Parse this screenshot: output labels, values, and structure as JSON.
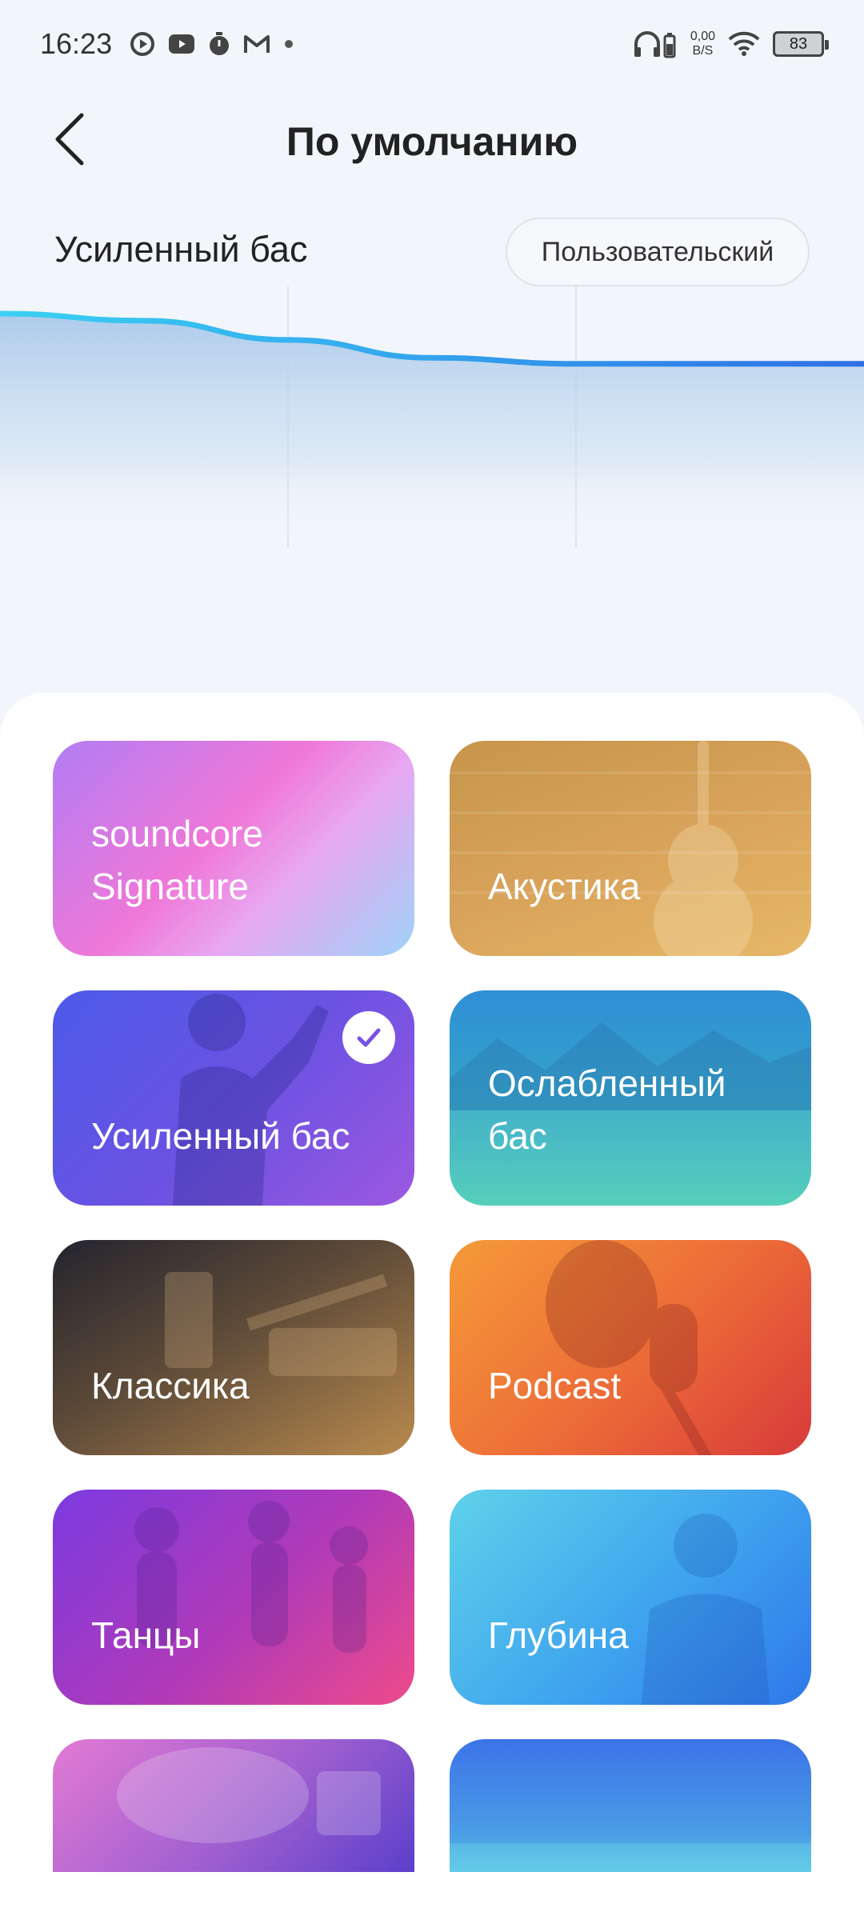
{
  "status_bar": {
    "time": "16:23",
    "net_speed_value": "0,00",
    "net_speed_unit": "B/S",
    "battery": "83",
    "icons": [
      "play-circle-icon",
      "youtube-icon",
      "timer-icon",
      "gmail-icon",
      "dot-icon",
      "headphones-battery-icon",
      "wifi-icon",
      "battery-icon"
    ]
  },
  "header": {
    "title": "По умолчанию",
    "back_icon": "chevron-left-icon"
  },
  "eq": {
    "current_preset": "Усиленный бас",
    "custom_button": "Пользовательский",
    "curve_levels": [
      0.92,
      0.86,
      0.7,
      0.55,
      0.5,
      0.5,
      0.5
    ]
  },
  "presets": [
    {
      "label": "soundcore\nSignature",
      "selected": false
    },
    {
      "label": "Акустика",
      "selected": false
    },
    {
      "label": "Усиленный бас",
      "selected": true
    },
    {
      "label": "Ослабленный\nбас",
      "selected": false
    },
    {
      "label": "Классика",
      "selected": false
    },
    {
      "label": "Podcast",
      "selected": false
    },
    {
      "label": "Танцы",
      "selected": false
    },
    {
      "label": "Глубина",
      "selected": false
    }
  ],
  "colors": {
    "accent_start": "#3cd0f2",
    "accent_end": "#2f6fe6",
    "background": "#f2f6fa"
  }
}
